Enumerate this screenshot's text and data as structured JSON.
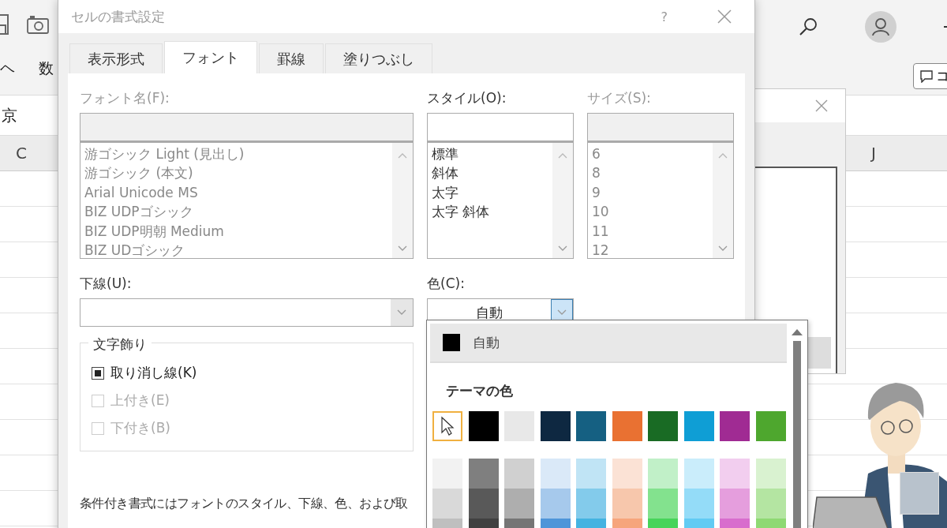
{
  "excel": {
    "ribbon_tabs": [
      "ヘ",
      "数"
    ],
    "comment_button": "コ",
    "formula_value": "京",
    "column_headers": [
      "C",
      "J"
    ]
  },
  "dialog": {
    "title": "セルの書式設定",
    "help": "?",
    "tabs": [
      {
        "label": "表示形式",
        "selected": false
      },
      {
        "label": "フォント",
        "selected": true
      },
      {
        "label": "罫線",
        "selected": false
      },
      {
        "label": "塗りつぶし",
        "selected": false
      }
    ],
    "font_name": {
      "label": "フォント名(F):",
      "disabled": true,
      "items": [
        "游ゴシック Light (見出し)",
        "游ゴシック (本文)",
        "Arial Unicode MS",
        "BIZ UDPゴシック",
        "BIZ UDP明朝 Medium",
        "BIZ UDゴシック"
      ]
    },
    "font_style": {
      "label": "スタイル(O):",
      "disabled": false,
      "items": [
        "標準",
        "斜体",
        "太字",
        "太字 斜体"
      ]
    },
    "font_size": {
      "label": "サイズ(S):",
      "disabled": true,
      "items": [
        "6",
        "8",
        "9",
        "10",
        "11",
        "12"
      ]
    },
    "underline": {
      "label": "下線(U):"
    },
    "color": {
      "label": "色(C):",
      "value": "自動",
      "expanded": true
    },
    "effects": {
      "title": "文字飾り",
      "options": [
        {
          "label": "取り消し線(K)",
          "checked": true,
          "disabled": false
        },
        {
          "label": "上付き(E)",
          "checked": false,
          "disabled": true
        },
        {
          "label": "下付き(B)",
          "checked": false,
          "disabled": true
        }
      ]
    },
    "note": "条件付き書式にはフォントのスタイル、下線、色、および取"
  },
  "color_menu": {
    "automatic": "自動",
    "theme_heading": "テーマの色",
    "theme_colors": [
      {
        "color": "#ffffff",
        "selected": true
      },
      {
        "color": "#000000",
        "selected": false
      },
      {
        "color": "#e8e8e8",
        "selected": false
      },
      {
        "color": "#0e2841",
        "selected": false
      },
      {
        "color": "#156082",
        "selected": false
      },
      {
        "color": "#e97132",
        "selected": false
      },
      {
        "color": "#196b24",
        "selected": false
      },
      {
        "color": "#0f9ed5",
        "selected": false
      },
      {
        "color": "#a02b93",
        "selected": false
      },
      {
        "color": "#4ea72e",
        "selected": false
      }
    ],
    "shades": [
      {
        "swatches": [
          {
            "color": "#f2f2f2"
          },
          {
            "color": "#7f7f7f"
          },
          {
            "color": "#d0d0d0"
          },
          {
            "color": "#dae9f8"
          },
          {
            "color": "#c0e4f5"
          },
          {
            "color": "#fbe2d5"
          },
          {
            "color": "#c1f0c8"
          },
          {
            "color": "#caedfb"
          },
          {
            "color": "#f2ceef"
          },
          {
            "color": "#d9f2d0"
          }
        ]
      },
      {
        "swatches": [
          {
            "color": "#d9d9d9"
          },
          {
            "color": "#595959"
          },
          {
            "color": "#aeaeae"
          },
          {
            "color": "#a6c9ec"
          },
          {
            "color": "#83cbeb"
          },
          {
            "color": "#f7c7ac"
          },
          {
            "color": "#83e28e"
          },
          {
            "color": "#94dcf8"
          },
          {
            "color": "#e59edd"
          },
          {
            "color": "#b4e5a2"
          }
        ]
      },
      {
        "swatches": [
          {
            "color": "#bfbfbf"
          },
          {
            "color": "#404040"
          },
          {
            "color": "#757575"
          },
          {
            "color": "#4e95d9"
          },
          {
            "color": "#44b3e1"
          },
          {
            "color": "#f6a57c"
          },
          {
            "color": "#47d45a"
          },
          {
            "color": "#61cbf3"
          },
          {
            "color": "#d86dcd"
          },
          {
            "color": "#8ed973"
          }
        ]
      }
    ]
  }
}
